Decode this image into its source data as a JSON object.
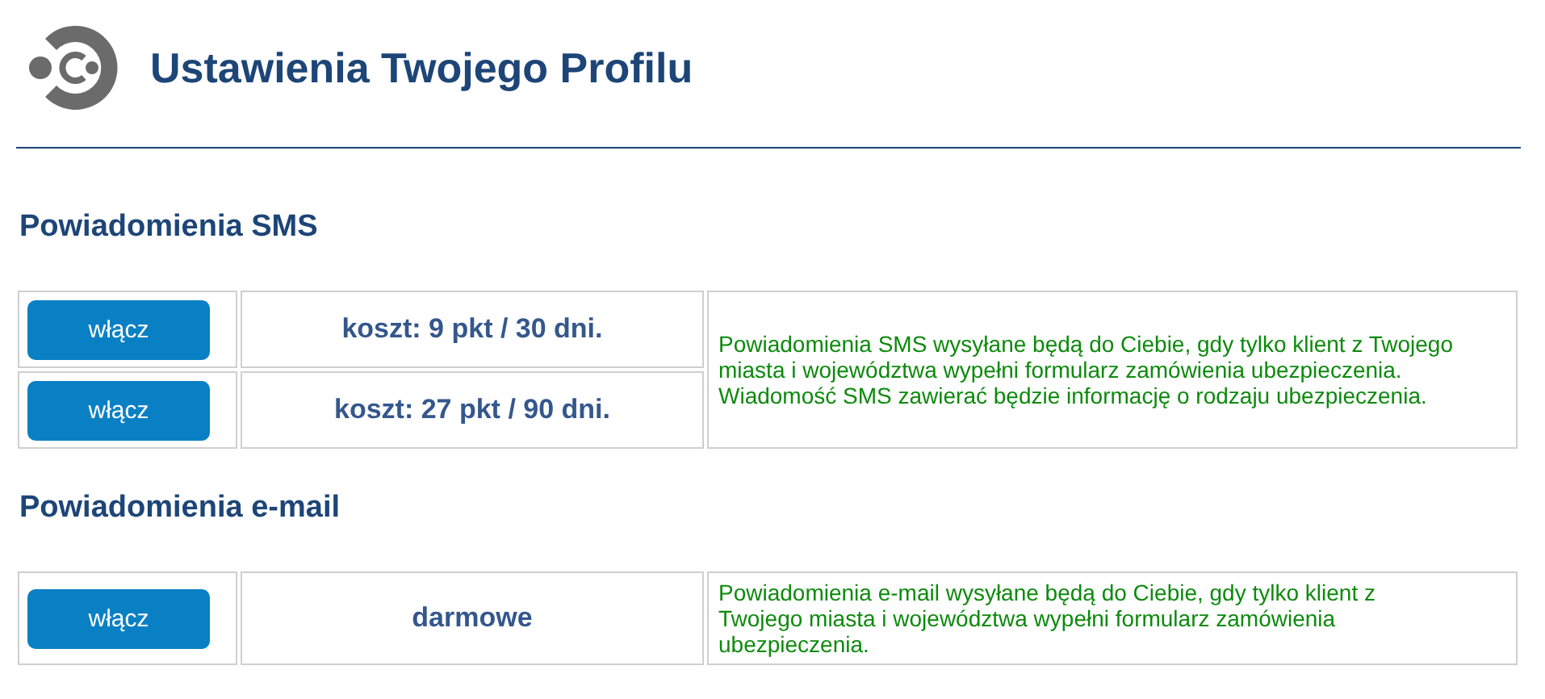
{
  "header": {
    "title": "Ustawienia Twojego Profilu"
  },
  "sections": [
    {
      "title": "Powiadomienia SMS",
      "options": [
        {
          "button": "włącz",
          "price": "koszt: 9 pkt / 30 dni."
        },
        {
          "button": "włącz",
          "price": "koszt: 27 pkt / 90 dni."
        }
      ],
      "description": "Powiadomienia SMS wysyłane będą do Ciebie, gdy tylko klient z Twojego miasta i województwa wypełni formularz zamówienia ubezpieczenia. Wiadomość SMS zawierać będzie informację o rodzaju ubezpieczenia."
    },
    {
      "title": "Powiadomienia e-mail",
      "options": [
        {
          "button": "włącz",
          "price": "darmowe"
        }
      ],
      "description": "Powiadomienia e-mail wysyłane będą do Ciebie, gdy tylko klient z Twojego miasta i województwa wypełni formularz zamówienia ubezpieczenia."
    }
  ]
}
